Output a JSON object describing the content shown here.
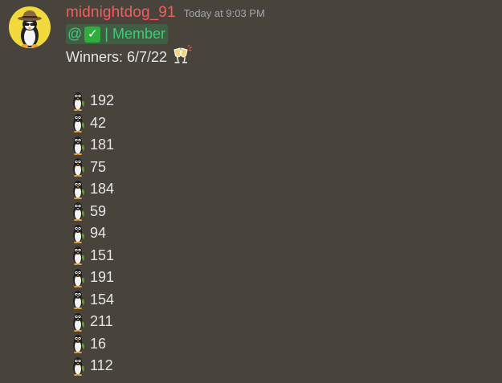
{
  "message": {
    "username": "midnightdog_91",
    "timestamp": "Today at 9:03 PM",
    "avatar_icon": "penguin-with-hat-avatar",
    "mention": {
      "prefix": "@",
      "emoji": "✓",
      "role": "| Member"
    },
    "winners_label": "Winners: 6/7/22",
    "winners_icon": "clinking-glasses-icon",
    "list_icon": "penguin-icon",
    "entries": [
      "192",
      "42",
      "181",
      "75",
      "184",
      "59",
      "94",
      "151",
      "191",
      "154",
      "211",
      "16",
      "112"
    ]
  },
  "colors": {
    "background": "#48443c",
    "username": "#f45c5c",
    "mention_text": "#43c97c",
    "timestamp": "#a3a6aa",
    "text": "#e4e5e7"
  }
}
